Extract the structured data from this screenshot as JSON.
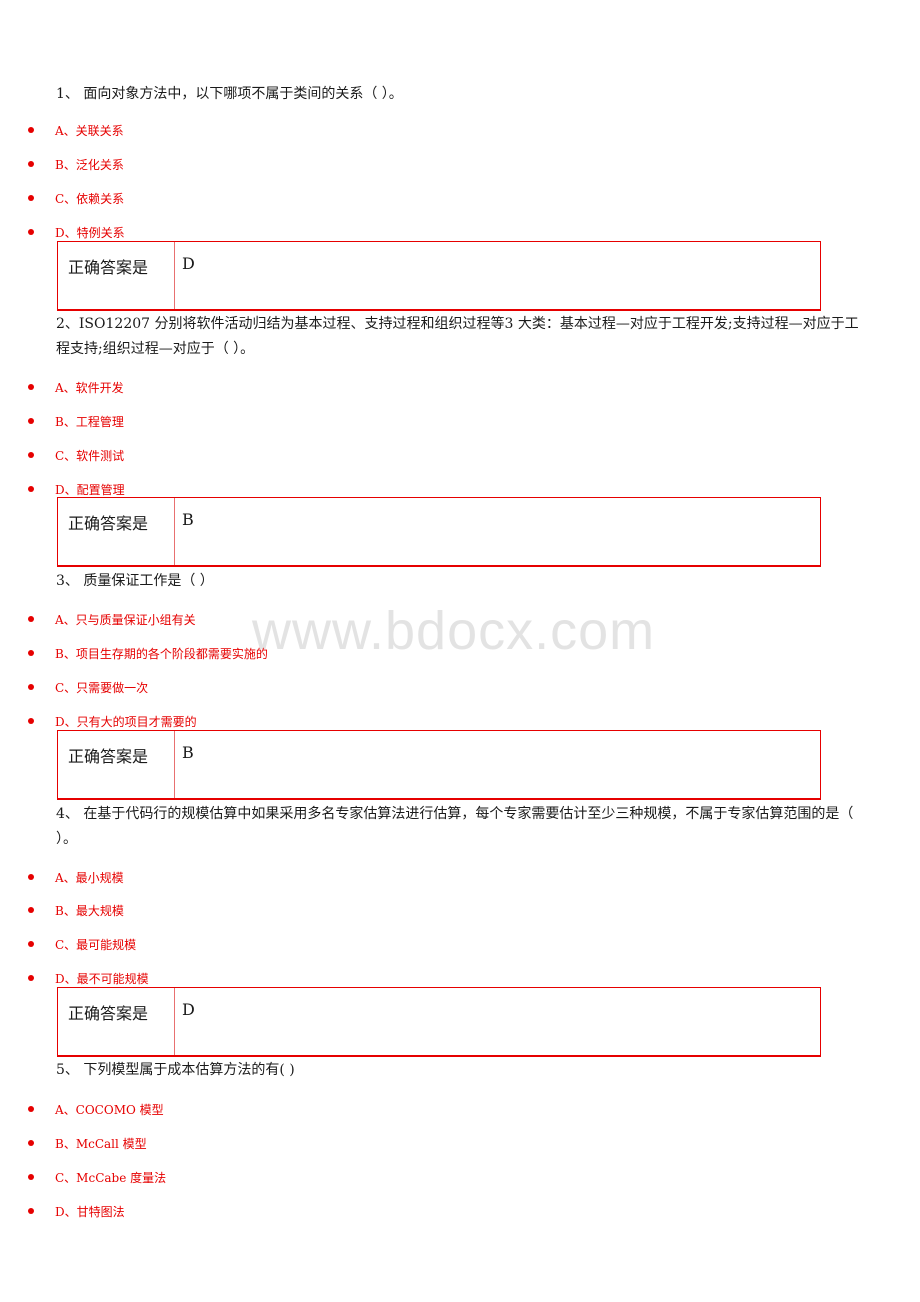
{
  "watermark": "www.bdocx.com",
  "answer_label": "正确答案是",
  "questions": [
    {
      "number": "1、",
      "text": "1、  面向对象方法中，以下哪项不属于类间的关系（ ）。",
      "options": [
        "A、关联关系",
        "B、泛化关系",
        "C、依赖关系",
        "D、特例关系"
      ],
      "answer": "D"
    },
    {
      "number": "2、",
      "text": "2、ISO12207 分别将软件活动归结为基本过程、支持过程和组织过程等3 大类：基本过程—对应于工程开发;支持过程—对应于工程支持;组织过程—对应于（ ）。",
      "options": [
        "A、软件开发",
        "B、工程管理",
        "C、软件测试",
        "D、配置管理"
      ],
      "answer": "B"
    },
    {
      "number": "3、",
      "text": "3、  质量保证工作是（ ）",
      "options": [
        "A、只与质量保证小组有关",
        "B、项目生存期的各个阶段都需要实施的",
        "C、只需要做一次",
        "D、只有大的项目才需要的"
      ],
      "answer": "B"
    },
    {
      "number": "4、",
      "text": "4、  在基于代码行的规模估算中如果采用多名专家估算法进行估算，每个专家需要估计至少三种规模，不属于专家估算范围的是（ ）。",
      "options": [
        "A、最小规模",
        "B、最大规模",
        "C、最可能规模",
        "D、最不可能规模"
      ],
      "answer": "D"
    },
    {
      "number": "5、",
      "text": "5、  下列模型属于成本估算方法的有( )",
      "options": [
        "A、COCOMO 模型",
        "B、McCall 模型",
        "C、McCabe 度量法",
        "D、甘特图法"
      ],
      "answer": null
    }
  ]
}
